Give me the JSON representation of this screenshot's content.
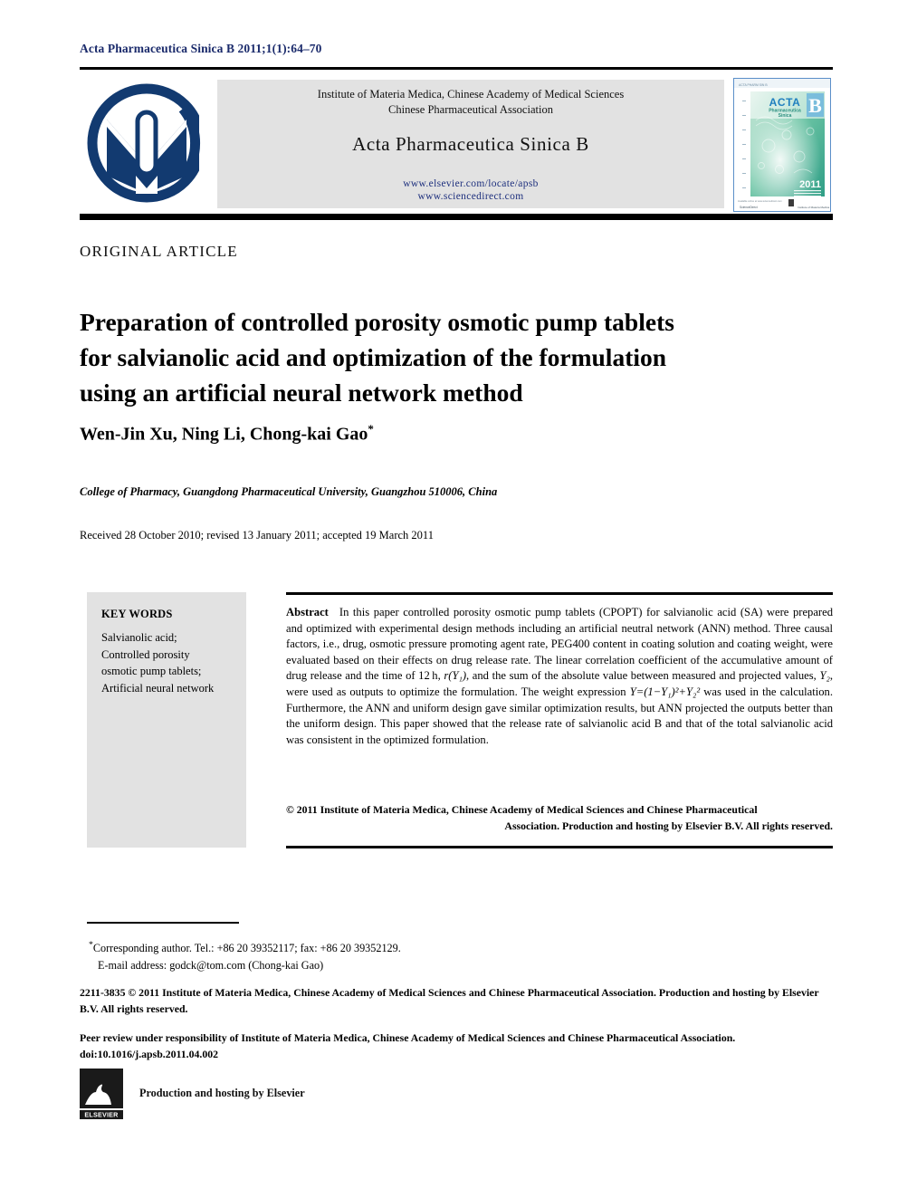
{
  "running_head": "Acta Pharmaceutica Sinica B 2011;1(1):64–70",
  "masthead": {
    "society_line1": "Institute of Materia Medica, Chinese Academy of Medical Sciences",
    "society_line2": "Chinese Pharmaceutical Association",
    "journal_title": "Acta Pharmaceutica Sinica B",
    "link_elsevier": "www.elsevier.com/locate/apsb",
    "link_sciencedirect": "www.sciencedirect.com",
    "logo_name": "imm-cams-logo",
    "cover": {
      "brand": "ACTA",
      "subtitle_line1": "Pharmaceutica",
      "subtitle_line2": "Sinica",
      "series_letter": "B",
      "year": "2011"
    },
    "colors": {
      "panel_gray": "#e2e2e2",
      "link_navy": "#1d2f7d",
      "logo_navy": "#123a70",
      "cover_border": "#5b8fc9"
    }
  },
  "article_type": "ORIGINAL ARTICLE",
  "title": {
    "line1": "Preparation of controlled porosity osmotic pump tablets",
    "line2": "for salvianolic acid and optimization of the formulation",
    "line3": "using an artificial neural network method"
  },
  "authors": {
    "names": "Wen-Jin Xu, Ning Li, Chong-kai Gao",
    "corresponding_marker": "*"
  },
  "affiliation": "College of Pharmacy, Guangdong Pharmaceutical University, Guangzhou 510006, China",
  "history": "Received 28 October 2010; revised 13 January 2011; accepted 19 March 2011",
  "keywords": {
    "heading": "KEY WORDS",
    "items": [
      "Salvianolic acid;",
      "Controlled porosity",
      "osmotic pump tablets;",
      "Artificial neural network"
    ]
  },
  "abstract": {
    "label": "Abstract",
    "part1": "In this paper controlled porosity osmotic pump tablets (CPOPT) for salvianolic acid (SA) were prepared and optimized with experimental design methods including an artificial neutral network (ANN) method. Three causal factors, i.e., drug, osmotic pressure promoting agent rate, PEG400 content in coating solution and coating weight, were evaluated based on their effects on drug release rate. The linear correlation coefficient of the accumulative amount of drug release and the time of 12 h, ",
    "math1": "r(Y₁)",
    "part2": ", and the sum of the absolute value between measured and projected values, ",
    "math2": "Y₂",
    "part3": ", were used as outputs to optimize the formulation. The weight expression ",
    "math3": "Y=(1−Y₁)²+Y₂²",
    "part4": " was used in the calculation. Furthermore, the ANN and uniform design gave similar optimization results, but ANN projected the outputs better than the uniform design. This paper showed that the release rate of salvianolic acid B and that of the total salvianolic acid was consistent in the optimized formulation.",
    "copyright_line1": "© 2011 Institute of Materia Medica, Chinese Academy of Medical Sciences and Chinese Pharmaceutical",
    "copyright_line2": "Association. Production and hosting by Elsevier B.V. All rights reserved."
  },
  "footnotes": {
    "corresponding": "Corresponding author. Tel.: +86 20 39352117; fax: +86 20 39352129.",
    "email": "E-mail address: godck@tom.com (Chong-kai Gao)",
    "issn_line": "2211-3835 © 2011 Institute of Materia Medica, Chinese Academy of Medical Sciences and Chinese Pharmaceutical Association. Production and hosting by Elsevier B.V. All rights reserved.",
    "peer_review": "Peer review under responsibility of Institute of Materia Medica, Chinese Academy of Medical Sciences and Chinese Pharmaceutical Association.",
    "doi": "doi:10.1016/j.apsb.2011.04.002",
    "elsevier_caption": "Production and hosting by Elsevier",
    "elsevier_wordmark": "ELSEVIER"
  }
}
